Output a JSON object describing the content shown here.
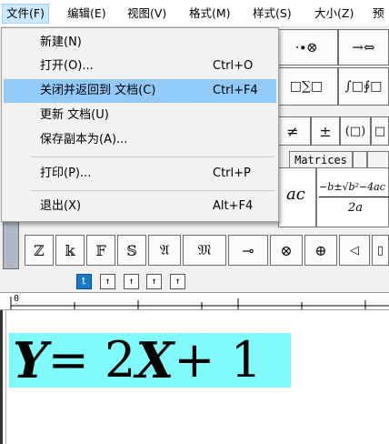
{
  "menubar": {
    "items": [
      "文件(F)",
      "编辑(E)",
      "视图(V)",
      "格式(M)",
      "样式(S)",
      "大小(Z)",
      "预"
    ]
  },
  "file_menu": {
    "items": [
      {
        "label": "新建(N)",
        "shortcut": ""
      },
      {
        "label": "打开(O)...",
        "shortcut": "Ctrl+O"
      },
      {
        "label": "关闭并返回到 文档(C)",
        "shortcut": "Ctrl+F4"
      },
      {
        "label": "更新 文档(U)",
        "shortcut": ""
      },
      {
        "label": "保存副本为(A)...",
        "shortcut": ""
      },
      {
        "label": "打印(P)...",
        "shortcut": "Ctrl+P"
      },
      {
        "label": "退出(X)",
        "shortcut": "Alt+F4"
      }
    ]
  },
  "palette": {
    "row1": [
      "⋅∙⊗",
      "→⇔"
    ],
    "row2": [
      "□∑□",
      "∫□∮□"
    ],
    "row3": [
      "≠",
      "±",
      "(□)",
      "□"
    ],
    "tab_label": "Matrices",
    "quadratic": {
      "numerator": "−b±√b²−4ac",
      "denominator": "2a",
      "fragment": "ac"
    },
    "bottom_row": [
      "ℤ",
      "𝕜",
      "𝔽",
      "𝕊",
      "𝔄",
      "𝔐",
      "⊸",
      "⊗",
      "⊕",
      "◁",
      "▯"
    ]
  },
  "nudge_buttons": [
    "⮤",
    "↑",
    "↑",
    "↑",
    "↑"
  ],
  "ruler": {
    "zero": "0"
  },
  "equation": {
    "lhs": "Y",
    "eq": " = 2",
    "var": "X",
    "rest": " + 1"
  },
  "colors": {
    "highlight": "#80fafa",
    "menu_hover": "#91c9f7",
    "nudge_selected": "#1979ca"
  }
}
